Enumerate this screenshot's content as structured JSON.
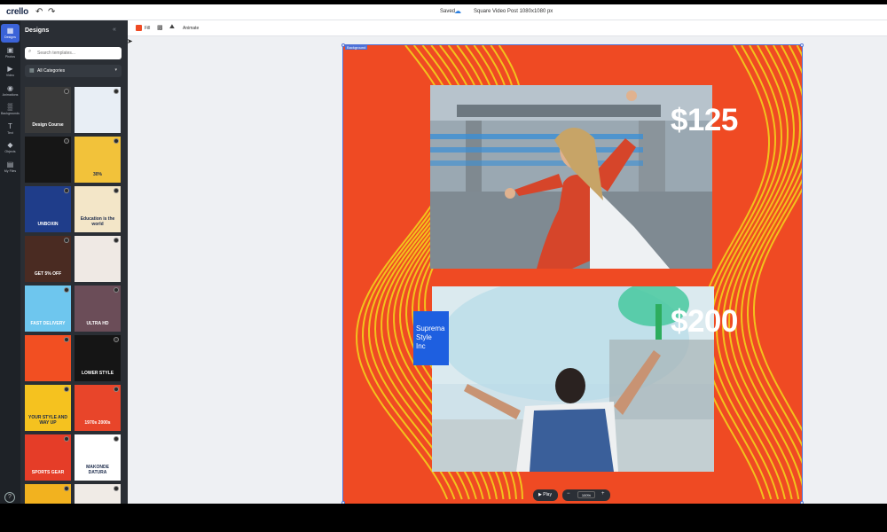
{
  "app": {
    "logo": "crello",
    "undo_icon": "undo-icon",
    "redo_icon": "redo-icon"
  },
  "topbar": {
    "saved_label": "Saved",
    "cloud_icon": "cloud-check-icon",
    "document_title": "Square Video Post 1080x1080 px"
  },
  "rail": {
    "items": [
      {
        "label": "Designs",
        "icon": "grid-icon",
        "active": true
      },
      {
        "label": "Photos",
        "icon": "photo-icon"
      },
      {
        "label": "Video",
        "icon": "video-icon"
      },
      {
        "label": "Animations",
        "icon": "play-circle-icon"
      },
      {
        "label": "Backgrounds",
        "icon": "pattern-icon"
      },
      {
        "label": "Text",
        "icon": "text-icon"
      },
      {
        "label": "Objects",
        "icon": "shapes-icon"
      },
      {
        "label": "My Files",
        "icon": "folder-icon"
      }
    ],
    "help_icon": "?"
  },
  "panel": {
    "title": "Designs",
    "collapse_icon": "«",
    "search_placeholder": "Search templates...",
    "category_label": "All Categories",
    "thumbs": [
      {
        "bg": "#3a3a3a",
        "text": "Design Course"
      },
      {
        "bg": "#e8eef5",
        "text": ""
      },
      {
        "bg": "#161616",
        "text": ""
      },
      {
        "bg": "#f2c23a",
        "text": "30%"
      },
      {
        "bg": "#1f3d8a",
        "text": "UNBOXIN"
      },
      {
        "bg": "#f3e6c8",
        "text": "Education is the world"
      },
      {
        "bg": "#4a2b22",
        "text": "GET 5% OFF"
      },
      {
        "bg": "#efe9e4",
        "text": ""
      },
      {
        "bg": "#6ec6ee",
        "text": "FAST DELIVERY"
      },
      {
        "bg": "#6b4d58",
        "text": "ULTRA HD"
      },
      {
        "bg": "#f24f22",
        "text": ""
      },
      {
        "bg": "#151515",
        "text": "LOWER STYLE"
      },
      {
        "bg": "#f5c21f",
        "text": "YOUR STYLE AND WAY UP"
      },
      {
        "bg": "#e8452a",
        "text": "1970s 2000s"
      },
      {
        "bg": "#e53d28",
        "text": "SPORTS GEAR"
      },
      {
        "bg": "#ffffff",
        "text": "MAKONDE DATURA"
      },
      {
        "bg": "#f2b21f",
        "text": ""
      },
      {
        "bg": "#f0ebe6",
        "text": ""
      }
    ]
  },
  "toolbar": {
    "fill_label": "Fill",
    "fill_color": "#ef4a23",
    "animate_label": "Animate"
  },
  "canvas": {
    "selection_label": "Background",
    "background_color": "#ef4a23",
    "wave_color": "#f2c21d",
    "price_top": "$125",
    "price_bottom": "$200",
    "brand_lines": [
      "Suprema",
      "Style",
      "Inc"
    ],
    "brand_color": "#1e5fe0"
  },
  "playback": {
    "play_label": "Play",
    "zoom_value": "100%"
  }
}
